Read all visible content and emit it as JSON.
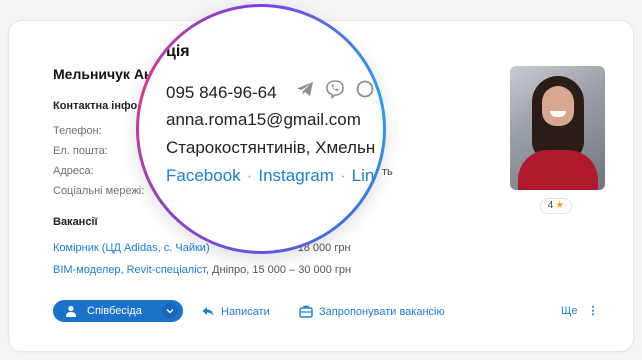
{
  "candidate": {
    "name_visible": "Мельничук Ан",
    "contact_heading_visible": "Контактна інфо",
    "labels": {
      "phone": "Телефон:",
      "email": "Ел. пошта:",
      "address": "Адреса:",
      "social": "Соціальні мережі:"
    },
    "background_fragment": "ть"
  },
  "lens": {
    "title_fragment": "ція",
    "phone": "095 846-96-64",
    "email": "anna.roma15@gmail.com",
    "address_visible": "Старокостянтинів, Хмельн",
    "social_links": [
      "Facebook",
      "Instagram",
      "Lin"
    ],
    "social_separator": "·",
    "contact_icons": [
      "telegram-icon",
      "viber-icon",
      "skype-icon"
    ]
  },
  "vacancies": {
    "heading": "Вакансії",
    "items": [
      {
        "title": "Комірник (ЦД Adidas, с. Чайки)",
        "rest": "18 000 грн"
      },
      {
        "title": "BIM-моделер, Revit-спеціаліст",
        "rest": ", Дніпро, 15 000 – 30 000 грн"
      }
    ]
  },
  "profile": {
    "rating": "4",
    "rating_star": "★"
  },
  "actions": {
    "interview": "Співбесіда",
    "write": "Написати",
    "offer": "Запропонувати вакансію",
    "more": "Ще"
  },
  "colors": {
    "accent": "#1a73c9",
    "link": "#1a7fd6",
    "star": "#f5a623"
  }
}
